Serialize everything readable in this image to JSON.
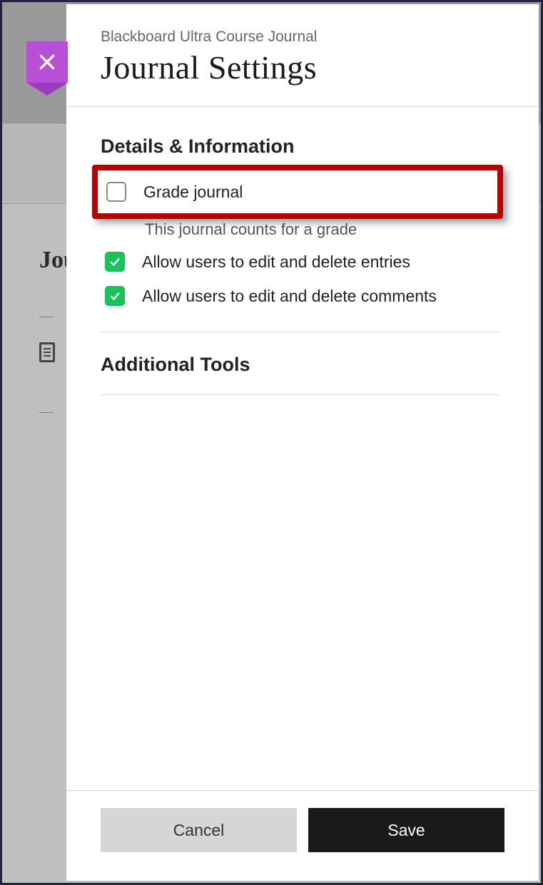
{
  "backdrop": {
    "heading": "Jou"
  },
  "panel": {
    "breadcrumb": "Blackboard Ultra Course Journal",
    "title": "Journal Settings",
    "sections": {
      "details": {
        "heading": "Details & Information",
        "grade_journal": {
          "label": "Grade journal",
          "description": "This journal counts for a grade",
          "checked": false
        },
        "allow_edit_entries": {
          "label": "Allow users to edit and delete entries",
          "checked": true
        },
        "allow_edit_comments": {
          "label": "Allow users to edit and delete comments",
          "checked": true
        }
      },
      "tools": {
        "heading": "Additional Tools"
      }
    },
    "footer": {
      "cancel": "Cancel",
      "save": "Save"
    }
  }
}
